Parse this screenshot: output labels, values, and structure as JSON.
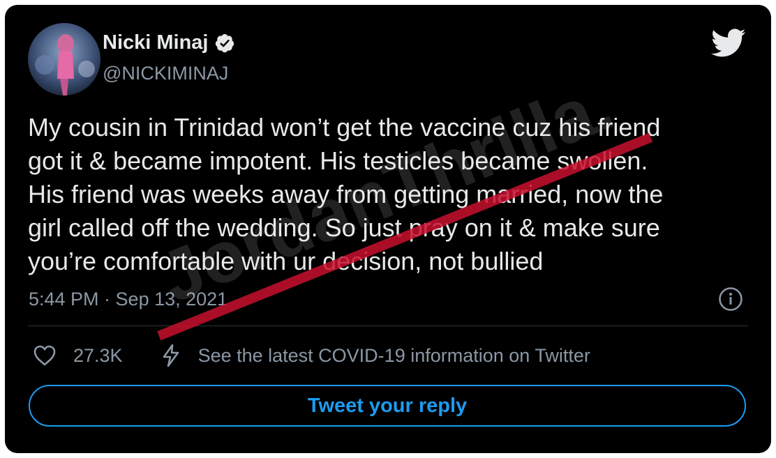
{
  "tweet": {
    "author": {
      "name": "Nicki Minaj",
      "handle": "@NICKIMINAJ",
      "verified": true
    },
    "lines": [
      "My cousin in Trinidad won’t get the vaccine cuz his friend",
      "got it & became impotent. His testicles became swollen.",
      "His friend was weeks away from getting married, now the",
      "girl called off the wedding. So just pray on it & make sure",
      "you’re comfortable with ur decision, not bullied"
    ],
    "timestamp": "5:44 PM · Sep 13, 2021",
    "likes": "27.3K",
    "covid_notice": "See the latest COVID-19 information on Twitter",
    "reply_label": "Tweet your reply"
  },
  "watermark": {
    "text": "JordanThrilla."
  },
  "icons": {
    "logo": "twitter-bird-icon",
    "verified": "verified-badge-icon",
    "info": "info-icon",
    "like": "heart-icon",
    "covid": "bolt-icon"
  },
  "colors": {
    "background": "#000000",
    "text": "#e7e9ea",
    "secondary": "#8b98a5",
    "accent": "#1d9bf0",
    "watermark_red": "#c8102e"
  }
}
